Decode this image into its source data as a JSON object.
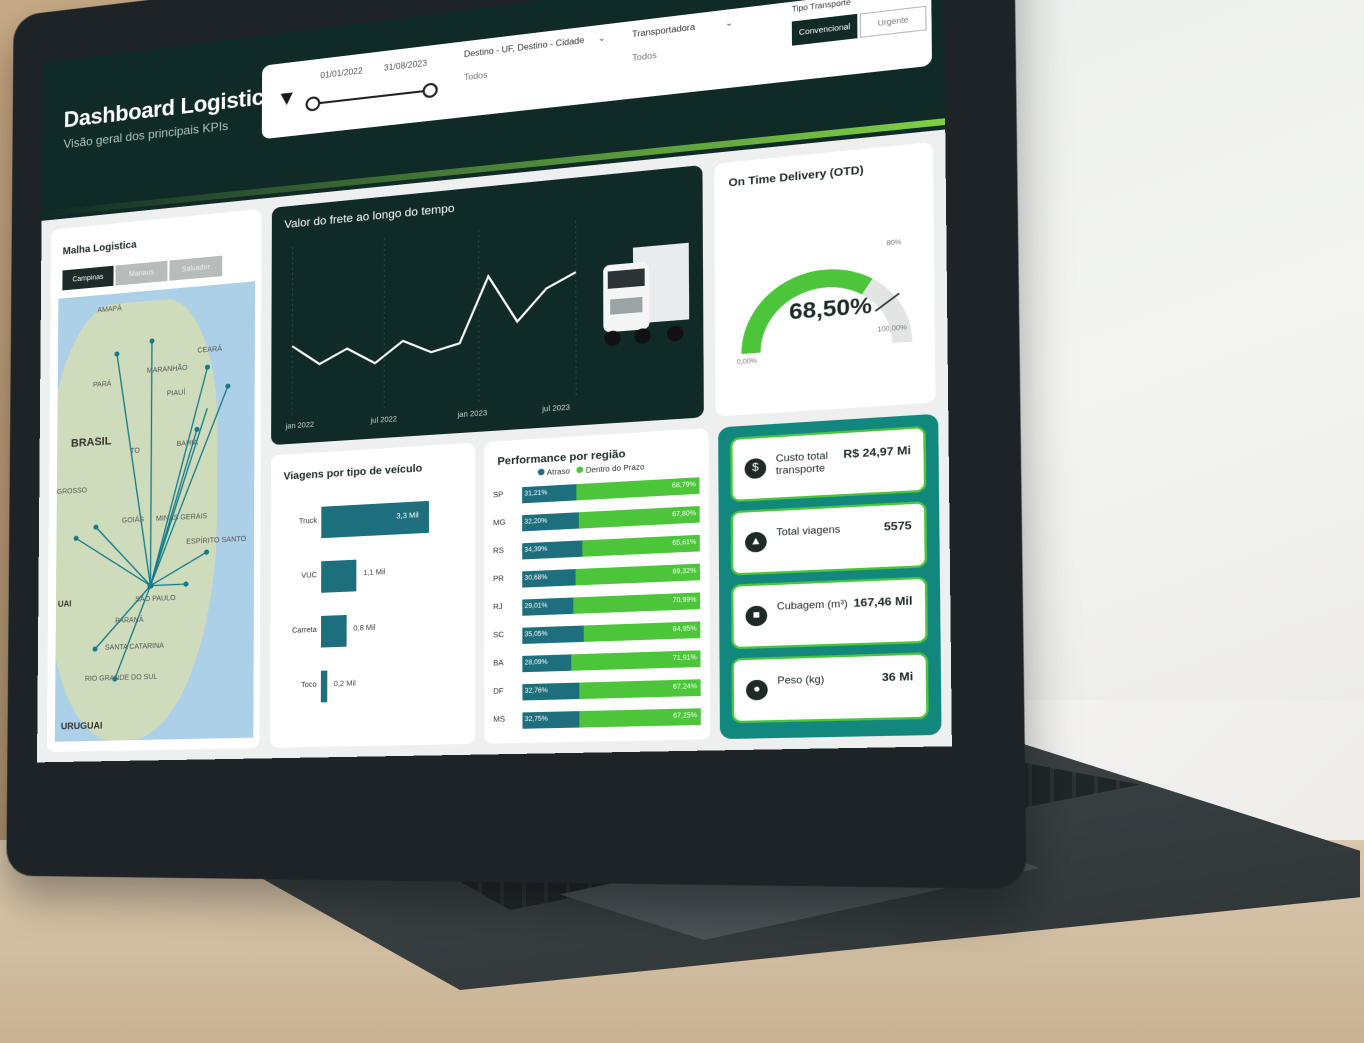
{
  "header": {
    "title": "Dashboard Logistica",
    "subtitle": "Visão geral dos principais KPIs"
  },
  "filters": {
    "date_start": "01/01/2022",
    "date_end": "31/08/2023",
    "destino_label": "Destino - UF, Destino - Cidade",
    "destino_value": "Todos",
    "transportadora_label": "Transportadora",
    "transportadora_value": "Todos",
    "tipo_label": "Tipo Transporte",
    "tipo_options": [
      "Convencional",
      "Urgente"
    ],
    "tipo_selected": "Convencional"
  },
  "map": {
    "title": "Malha Logistica",
    "buttons": [
      "Campinas",
      "Manaus",
      "Salvador"
    ],
    "selected": "Campinas",
    "labels": [
      "AMAPÁ",
      "CEARÁ",
      "PARÁ",
      "MARANHÃO",
      "PIAUÍ",
      "BAHIA",
      "TO",
      "GROSSO",
      "GOIÁS",
      "MINAS GERAIS",
      "ESPÍRITO SANTO",
      "SÃO PAULO",
      "PARANÁ",
      "SANTA CATARINA",
      "RIO GRANDE DO SUL"
    ],
    "country": "BRASIL",
    "neighbor": "URUGUAI",
    "paraguay": "UAI"
  },
  "line_chart": {
    "title": "Valor do frete ao longo do tempo",
    "x_ticks": [
      "jan 2022",
      "jul 2022",
      "jan 2023",
      "jul 2023"
    ]
  },
  "otd": {
    "title": "On Time Delivery (OTD)",
    "value": "68,50%",
    "value_fraction": 0.685,
    "target": "80%",
    "min": "0,00%",
    "max": "100,00%"
  },
  "viagens": {
    "title": "Viagens por tipo de veículo"
  },
  "performance": {
    "title": "Performance por região",
    "legend": [
      "Atraso",
      "Dentro do Prazo"
    ]
  },
  "kpis": [
    {
      "label": "Custo total transporte",
      "value": "R$ 24,97 Mi",
      "icon": "$"
    },
    {
      "label": "Total viagens",
      "value": "5575",
      "icon": "road"
    },
    {
      "label": "Cubagem (m³)",
      "value": "167,46 Mil",
      "icon": "box"
    },
    {
      "label": "Peso (kg)",
      "value": "36 Mi",
      "icon": "weight"
    }
  ],
  "colors": {
    "dark": "#102a27",
    "green": "#4cc53a",
    "teal": "#1d6f7d"
  },
  "chart_data": [
    {
      "type": "line",
      "title": "Valor do frete ao longo do tempo",
      "x": [
        "jan 2022",
        "mar 2022",
        "mai 2022",
        "jul 2022",
        "set 2022",
        "nov 2022",
        "jan 2023",
        "mar 2023",
        "mai 2023",
        "jul 2023",
        "ago 2023"
      ],
      "values": [
        40,
        28,
        36,
        26,
        38,
        30,
        34,
        72,
        44,
        62,
        70
      ]
    },
    {
      "type": "bar",
      "title": "Viagens por tipo de veículo",
      "categories": [
        "Truck",
        "VUC",
        "Carreta",
        "Toco"
      ],
      "values": [
        3.3,
        1.1,
        0.8,
        0.2
      ],
      "value_labels": [
        "3,3 Mil",
        "1,1 Mil",
        "0,8 Mil",
        "0,2 Mil"
      ]
    },
    {
      "type": "bar",
      "title": "Performance por região",
      "categories": [
        "SP",
        "MG",
        "RS",
        "PR",
        "RJ",
        "SC",
        "BA",
        "DF",
        "MS"
      ],
      "series": [
        {
          "name": "Atraso",
          "values": [
            31.21,
            32.2,
            34.39,
            30.68,
            29.01,
            35.05,
            28.09,
            32.76,
            32.75
          ],
          "labels": [
            "31,21%",
            "32,20%",
            "34,39%",
            "30,68%",
            "29,01%",
            "35,05%",
            "28,09%",
            "32,76%",
            "32,75%"
          ]
        },
        {
          "name": "Dentro do Prazo",
          "values": [
            68.79,
            67.8,
            65.61,
            69.32,
            70.99,
            64.95,
            71.91,
            67.24,
            67.25
          ],
          "labels": [
            "68,79%",
            "67,80%",
            "65,61%",
            "69,32%",
            "70,99%",
            "64,95%",
            "71,91%",
            "67,24%",
            "67,25%"
          ]
        }
      ]
    }
  ]
}
